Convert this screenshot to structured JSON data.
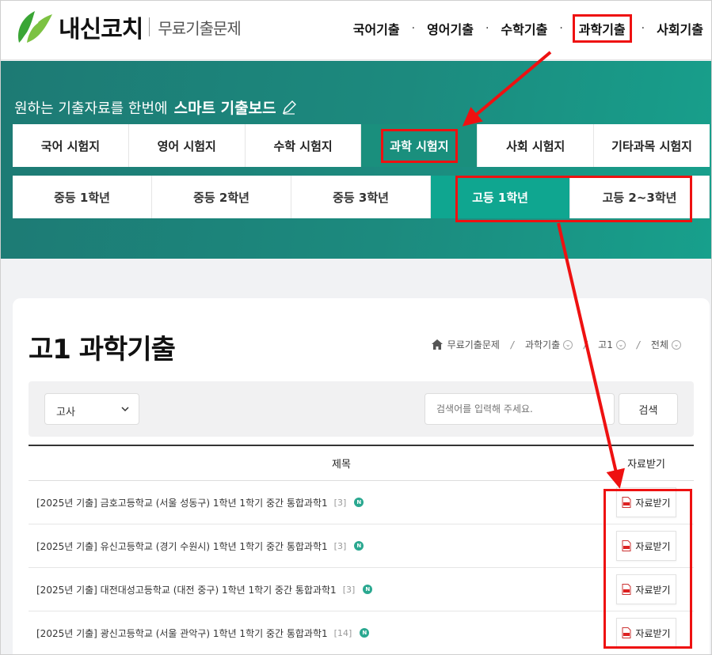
{
  "header": {
    "logo_text": "내신코치",
    "logo_sub": "무료기출문제",
    "nav": [
      "국어기출",
      "영어기출",
      "수학기출",
      "과학기출",
      "사회기출"
    ],
    "active_nav_index": 3
  },
  "hero": {
    "title_prefix": "원하는 기출자료를 한번에",
    "title_bold": "스마트 기출보드",
    "subject_tabs": [
      "국어 시험지",
      "영어 시험지",
      "수학 시험지",
      "과학 시험지",
      "사회 시험지",
      "기타과목 시험지"
    ],
    "active_subject_index": 3,
    "grade_tabs": [
      "중등 1학년",
      "중등 2학년",
      "중등 3학년",
      "고등 1학년",
      "고등 2~3학년"
    ],
    "active_grade_index": 3
  },
  "content": {
    "page_title": "고1 과학기출",
    "breadcrumb": [
      "무료기출문제",
      "과학기출",
      "고1",
      "전체"
    ],
    "filter_select": "고사",
    "search_placeholder": "검색어를 입력해 주세요.",
    "search_button": "검색",
    "table_headers": {
      "title": "제목",
      "download": "자료받기"
    },
    "rows": [
      {
        "title": "[2025년 기출] 금호고등학교 (서울 성동구) 1학년 1학기 중간 통합과학1",
        "count": "[3]",
        "badge": "N",
        "download": "자료받기"
      },
      {
        "title": "[2025년 기출] 유신고등학교 (경기 수원시) 1학년 1학기 중간 통합과학1",
        "count": "[3]",
        "badge": "N",
        "download": "자료받기"
      },
      {
        "title": "[2025년 기출] 대전대성고등학교 (대전 중구) 1학년 1학기 중간 통합과학1",
        "count": "[3]",
        "badge": "N",
        "download": "자료받기"
      },
      {
        "title": "[2025년 기출] 광신고등학교 (서울 관악구) 1학년 1학기 중간 통합과학1",
        "count": "[14]",
        "badge": "N",
        "download": "자료받기"
      }
    ]
  },
  "colors": {
    "brand_green": "#1a8f7d",
    "highlight_red": "#ee1111",
    "badge_green": "#2aa890"
  }
}
